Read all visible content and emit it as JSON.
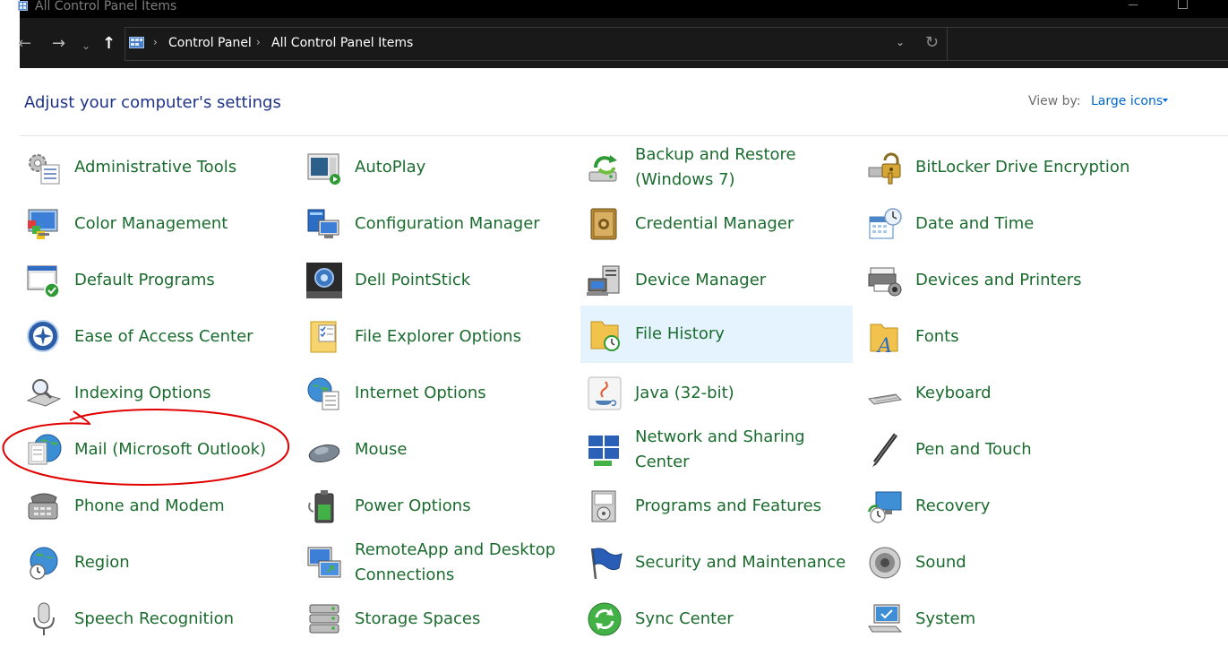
{
  "window": {
    "title": "All Control Panel Items",
    "minimize_icon": "minimize-icon",
    "maximize_icon": "maximize-icon"
  },
  "nav": {
    "back_icon": "back-arrow-icon",
    "back_glyph": "←",
    "forward_icon": "forward-arrow-icon",
    "forward_glyph": "→",
    "recent_icon": "chevron-down-icon",
    "recent_glyph": "⌄",
    "up_icon": "up-arrow-icon",
    "up_glyph": "↑",
    "address": {
      "breadcrumbs": [
        "Control Panel",
        "All Control Panel Items"
      ],
      "separator_glyph": "›",
      "dropdown_glyph": "⌄",
      "refresh_glyph": "↻"
    },
    "search": {
      "placeholder": ""
    }
  },
  "heading": "Adjust your computer's settings",
  "view_by": {
    "label": "View by:",
    "value": "Large icons"
  },
  "colors": {
    "item_text": "#1a6b2e",
    "heading": "#1e3287",
    "link": "#0066cc",
    "hover_bg": "#e5f3ff",
    "annotation": "#e00000"
  },
  "items": [
    [
      "Administrative Tools",
      "AutoPlay",
      "Backup and Restore (Windows 7)",
      "BitLocker Drive Encryption"
    ],
    [
      "Color Management",
      "Configuration Manager",
      "Credential Manager",
      "Date and Time"
    ],
    [
      "Default Programs",
      "Dell PointStick",
      "Device Manager",
      "Devices and Printers"
    ],
    [
      "Ease of Access Center",
      "File Explorer Options",
      "File History",
      "Fonts"
    ],
    [
      "Indexing Options",
      "Internet Options",
      "Java (32-bit)",
      "Keyboard"
    ],
    [
      "Mail (Microsoft Outlook)",
      "Mouse",
      "Network and Sharing Center",
      "Pen and Touch"
    ],
    [
      "Phone and Modem",
      "Power Options",
      "Programs and Features",
      "Recovery"
    ],
    [
      "Region",
      "RemoteApp and Desktop Connections",
      "Security and Maintenance",
      "Sound"
    ],
    [
      "Speech Recognition",
      "Storage Spaces",
      "Sync Center",
      "System"
    ]
  ],
  "icons": [
    [
      "admin-tools-icon",
      "autoplay-icon",
      "backup-restore-icon",
      "bitlocker-icon"
    ],
    [
      "color-management-icon",
      "configuration-manager-icon",
      "credential-manager-icon",
      "date-time-icon"
    ],
    [
      "default-programs-icon",
      "pointstick-icon",
      "device-manager-icon",
      "devices-printers-icon"
    ],
    [
      "ease-of-access-icon",
      "folder-options-icon",
      "file-history-icon",
      "fonts-icon"
    ],
    [
      "indexing-icon",
      "internet-options-icon",
      "java-icon",
      "keyboard-icon"
    ],
    [
      "mail-icon",
      "mouse-icon",
      "network-sharing-icon",
      "pen-touch-icon"
    ],
    [
      "phone-modem-icon",
      "power-options-icon",
      "programs-features-icon",
      "recovery-icon"
    ],
    [
      "region-icon",
      "remoteapp-icon",
      "security-maintenance-icon",
      "sound-icon"
    ],
    [
      "speech-recognition-icon",
      "storage-spaces-icon",
      "sync-center-icon",
      "system-icon"
    ]
  ],
  "hovered_item": "File History",
  "annotation": "circle around Mail (Microsoft Outlook)"
}
